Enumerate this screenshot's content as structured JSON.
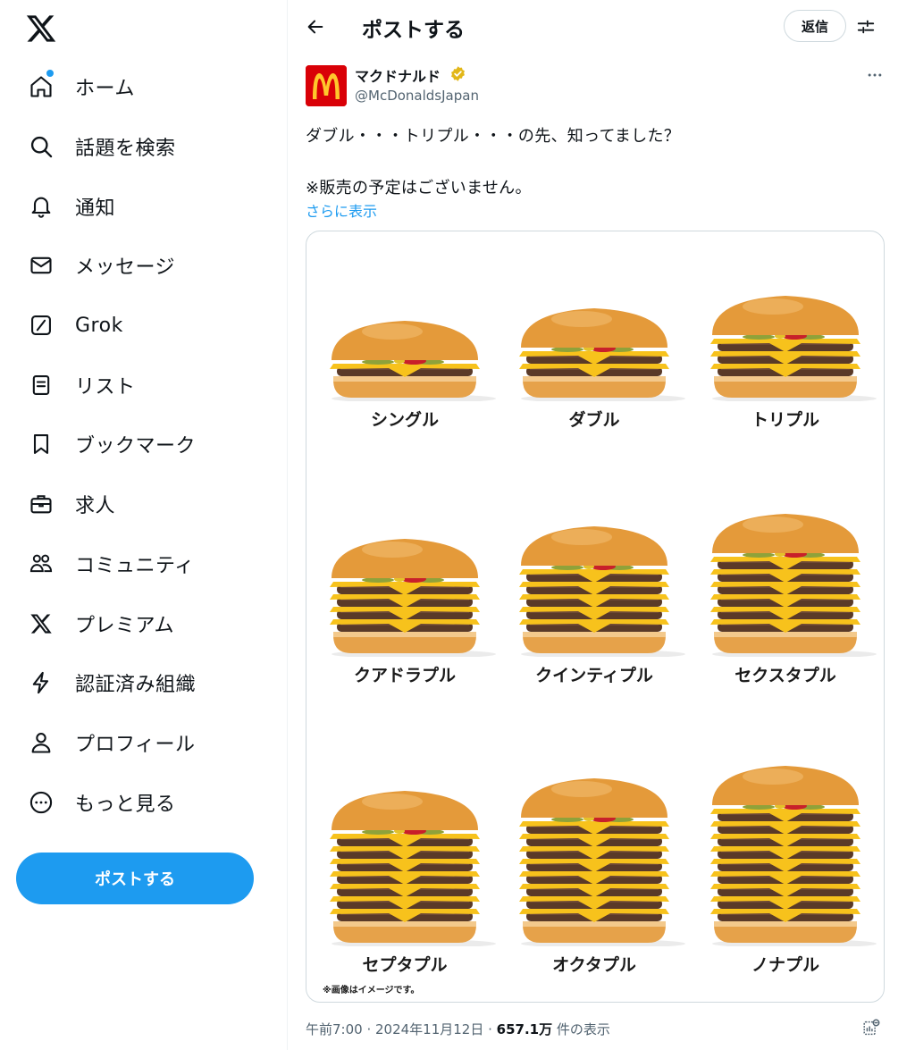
{
  "nav": {
    "items": [
      {
        "label": "ホーム",
        "icon": "home-icon"
      },
      {
        "label": "話題を検索",
        "icon": "search-icon"
      },
      {
        "label": "通知",
        "icon": "bell-icon"
      },
      {
        "label": "メッセージ",
        "icon": "mail-icon"
      },
      {
        "label": "Grok",
        "icon": "grok-icon"
      },
      {
        "label": "リスト",
        "icon": "list-icon"
      },
      {
        "label": "ブックマーク",
        "icon": "bookmark-icon"
      },
      {
        "label": "求人",
        "icon": "briefcase-icon"
      },
      {
        "label": "コミュニティ",
        "icon": "communities-icon"
      },
      {
        "label": "プレミアム",
        "icon": "x-premium-icon"
      },
      {
        "label": "認証済み組織",
        "icon": "lightning-icon"
      },
      {
        "label": "プロフィール",
        "icon": "profile-icon"
      },
      {
        "label": "もっと見る",
        "icon": "more-circle-icon"
      }
    ],
    "post_button": "ポストする"
  },
  "header": {
    "title": "ポストする",
    "reply_button": "返信"
  },
  "post": {
    "author_name": "マクドナルド",
    "author_handle": "@McDonaldsJapan",
    "text_line1": "ダブル・・・トリプル・・・の先、知ってました？",
    "text_line2": "※販売の予定はございません。",
    "show_more": "さらに表示",
    "timestamp": "午前7:00 · 2024年11月12日 · ",
    "views_count": "657.1万",
    "views_label": " 件の表示"
  },
  "image": {
    "burgers": [
      {
        "label": "シングル",
        "patties": 1
      },
      {
        "label": "ダブル",
        "patties": 2
      },
      {
        "label": "トリプル",
        "patties": 3
      },
      {
        "label": "クアドラプル",
        "patties": 4
      },
      {
        "label": "クインティプル",
        "patties": 5
      },
      {
        "label": "セクスタプル",
        "patties": 6
      },
      {
        "label": "セプタプル",
        "patties": 7
      },
      {
        "label": "オクタプル",
        "patties": 8
      },
      {
        "label": "ノナプル",
        "patties": 9
      }
    ],
    "disclaimer": "※画像はイメージです。"
  },
  "colors": {
    "accent": "#1d9bf0",
    "brand_red": "#d90007",
    "brand_yellow": "#ffc72c",
    "bun": "#e8a23c",
    "patty": "#5a3a28",
    "cheese": "#f7c21c"
  }
}
